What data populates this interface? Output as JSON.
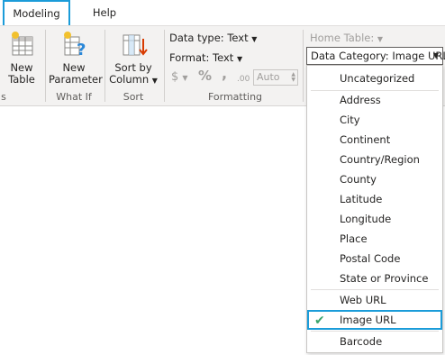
{
  "tabs": [
    {
      "label": "Modeling",
      "active": true
    },
    {
      "label": "Help",
      "active": false
    }
  ],
  "ribbon": {
    "groups": {
      "calc_label": "s",
      "whatif_label": "What If",
      "sort_label": "Sort",
      "formatting_label": "Formatting"
    },
    "new_table": {
      "line1": "New",
      "line2": "Table"
    },
    "new_parameter": {
      "line1": "New",
      "line2": "Parameter"
    },
    "sort_by_column": {
      "line1": "Sort by",
      "line2": "Column"
    },
    "data_type": "Data type: Text",
    "format": "Format: Text",
    "currency_symbol": "$",
    "percent_symbol": "%",
    "comma_symbol": ",",
    "decimal_symbol": ".00",
    "auto_value": "Auto",
    "home_table": "Home Table:",
    "data_category": "Data Category: Image URL"
  },
  "dropdown": {
    "items": [
      {
        "label": "Uncategorized"
      },
      {
        "label": "Address"
      },
      {
        "label": "City"
      },
      {
        "label": "Continent"
      },
      {
        "label": "Country/Region"
      },
      {
        "label": "County"
      },
      {
        "label": "Latitude"
      },
      {
        "label": "Longitude"
      },
      {
        "label": "Place"
      },
      {
        "label": "Postal Code"
      },
      {
        "label": "State or Province"
      },
      {
        "label": "Web URL"
      },
      {
        "label": "Image URL",
        "selected": true
      },
      {
        "label": "Barcode"
      }
    ]
  },
  "colors": {
    "accent": "#1b9cd9",
    "check": "#3aa46b",
    "ribbon_bg": "#f3f2f1"
  }
}
